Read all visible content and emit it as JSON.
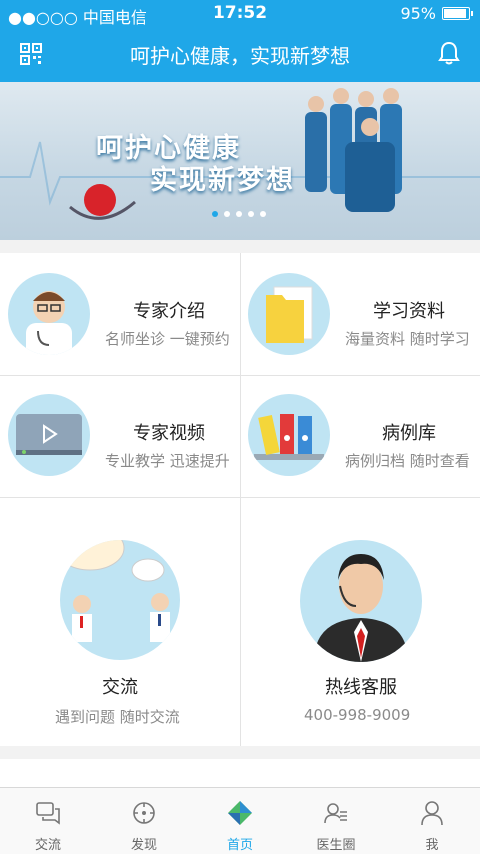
{
  "status": {
    "carrier": "●●○○○ 中国电信",
    "time": "17:52",
    "battery": "95%"
  },
  "nav": {
    "title": "呵护心健康，实现新梦想"
  },
  "banner": {
    "line1": "呵护心健康",
    "line2": "实现新梦想",
    "dots": 5,
    "active_dot": 0
  },
  "cards": [
    {
      "name": "专家介绍",
      "sub": "名师坐诊 一键预约",
      "icon": "doctor-icon"
    },
    {
      "name": "学习资料",
      "sub": "海量资料 随时学习",
      "icon": "folder-icon"
    },
    {
      "name": "专家视频",
      "sub": "专业教学 迅速提升",
      "icon": "video-icon"
    },
    {
      "name": "病例库",
      "sub": "病例归档 随时查看",
      "icon": "binders-icon"
    },
    {
      "name": "交流",
      "sub": "遇到问题 随时交流",
      "icon": "chat-people-icon"
    },
    {
      "name": "热线客服",
      "sub": "400-998-9009",
      "icon": "headset-agent-icon"
    }
  ],
  "tabs": [
    {
      "label": "交流",
      "icon": "chat-icon"
    },
    {
      "label": "发现",
      "icon": "compass-icon"
    },
    {
      "label": "首页",
      "icon": "home-diamond-icon",
      "active": true
    },
    {
      "label": "医生圈",
      "icon": "doctor-circle-icon"
    },
    {
      "label": "我",
      "icon": "person-icon"
    }
  ],
  "colors": {
    "accent": "#1fa7e8",
    "circle": "#bfe4f3"
  }
}
